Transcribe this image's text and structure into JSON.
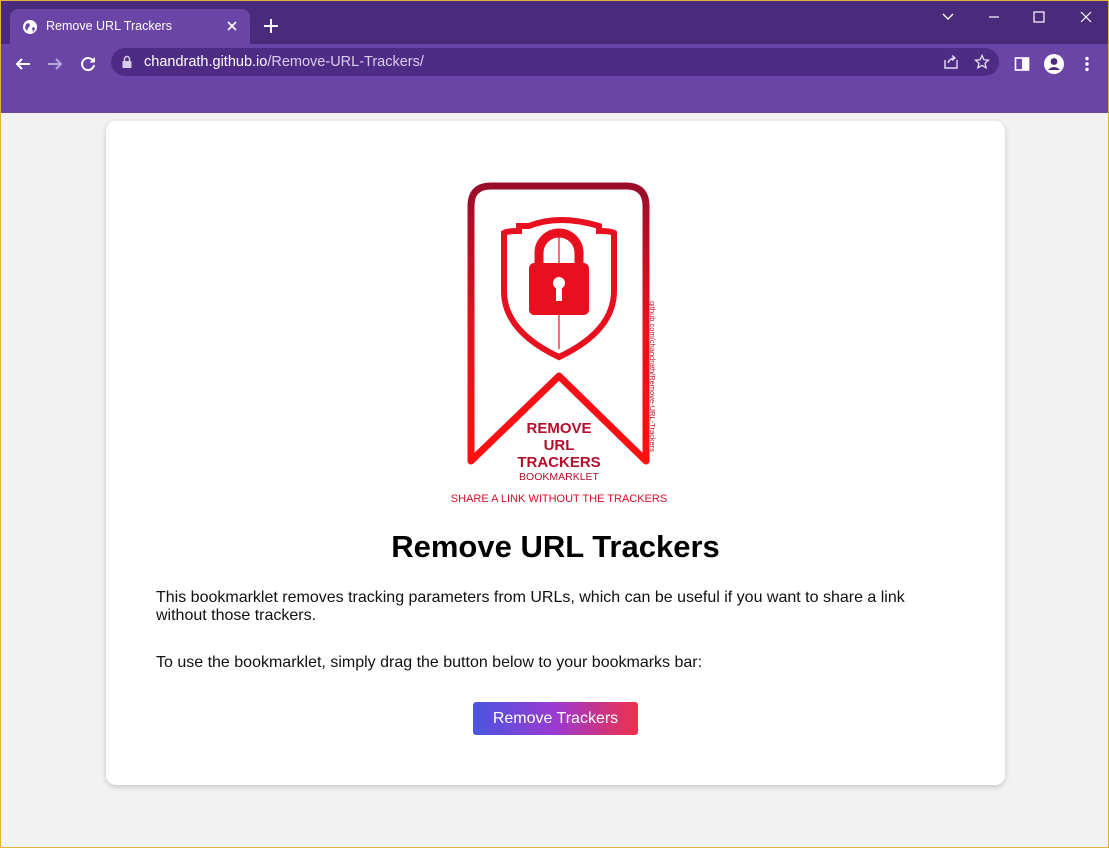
{
  "browser": {
    "tab": {
      "title": "Remove URL Trackers",
      "favicon": "globe-icon"
    },
    "address": {
      "host": "chandrath.github.io",
      "path": "/Remove-URL-Trackers/"
    },
    "colors": {
      "frame": "#4a2a7b",
      "toolbar": "#6b45a5"
    }
  },
  "page": {
    "logo": {
      "lines": [
        "REMOVE",
        "URL",
        "TRACKERS"
      ],
      "subtitle": "BOOKMARKLET",
      "tagline": "SHARE A LINK WITHOUT THE TRACKERS",
      "side_text": "github.com/chandrath/Remove-URL-Trackers"
    },
    "heading": "Remove URL Trackers",
    "intro": "This bookmarklet removes tracking parameters from URLs, which can be useful if you want to share a link without those trackers.",
    "instruction": "To use the bookmarklet, simply drag the button below to your bookmarks bar:",
    "button_label": "Remove Trackers"
  }
}
